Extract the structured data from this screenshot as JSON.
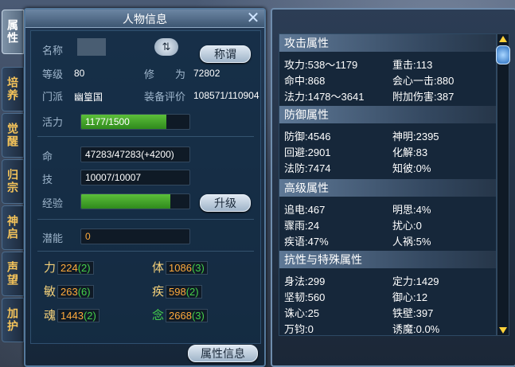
{
  "tabs": [
    "属性",
    "培养",
    "觉醒",
    "归宗",
    "神启",
    "声望",
    "加护"
  ],
  "panel": {
    "title": "人物信息",
    "footer_button": "属性信息"
  },
  "profile": {
    "name_label": "名称",
    "name_value": "",
    "title_button": "称谓",
    "level_label": "等级",
    "level_value": "80",
    "cultivation_label": "修　　为",
    "cultivation_value": "72802",
    "sect_label": "门派",
    "sect_value": "幽篁国",
    "equip_label": "装备评价",
    "equip_value": "108571/110904",
    "vitality_label": "活力",
    "vitality_value": "1177/1500",
    "vitality_fill": 0.785,
    "life_label": "命",
    "life_value": "47283/47283(+4200)",
    "skill_label": "技",
    "skill_value": "10007/10007",
    "exp_label": "经验",
    "exp_fill": 0.82,
    "levelup_button": "升级",
    "potential_label": "潜能",
    "potential_value": "0"
  },
  "attributes": [
    {
      "name": "力",
      "base": "224",
      "bonus": "(2)"
    },
    {
      "name": "体",
      "base": "1086",
      "bonus": "(3)"
    },
    {
      "name": "敏",
      "base": "263",
      "bonus": "(6)"
    },
    {
      "name": "疾",
      "base": "598",
      "bonus": "(2)"
    },
    {
      "name": "魂",
      "base": "1443",
      "bonus": "(2)"
    },
    {
      "name": "念",
      "base": "2668",
      "bonus": "(3)"
    }
  ],
  "sections": {
    "attack": {
      "title": "攻击属性",
      "rows": [
        [
          "攻力:538～1179",
          "重击:113"
        ],
        [
          "命中:868",
          "会心一击:880"
        ],
        [
          "法力:1478～3641",
          "附加伤害:387"
        ]
      ]
    },
    "defense": {
      "title": "防御属性",
      "rows": [
        [
          "防御:4546",
          "神明:2395"
        ],
        [
          "回避:2901",
          "化解:83"
        ],
        [
          "法防:7474",
          "知彼:0%"
        ]
      ]
    },
    "advanced": {
      "title": "高级属性",
      "rows": [
        [
          "追电:467",
          "明思:4%"
        ],
        [
          "骤雨:24",
          "扰心:0"
        ],
        [
          "疾语:47%",
          "人祸:5%"
        ]
      ]
    },
    "resist": {
      "title": "抗性与特殊属性",
      "rows": [
        [
          "身法:299",
          "定力:1429"
        ],
        [
          "坚韧:560",
          "御心:12"
        ],
        [
          "诛心:25",
          "铁壁:397"
        ],
        [
          "万钧:0",
          "诱魔:0.0%"
        ]
      ]
    }
  },
  "colors": {
    "accent": "#f6d27a",
    "bonus_green": "#44d04a",
    "bar_green": "#3fa52a"
  }
}
